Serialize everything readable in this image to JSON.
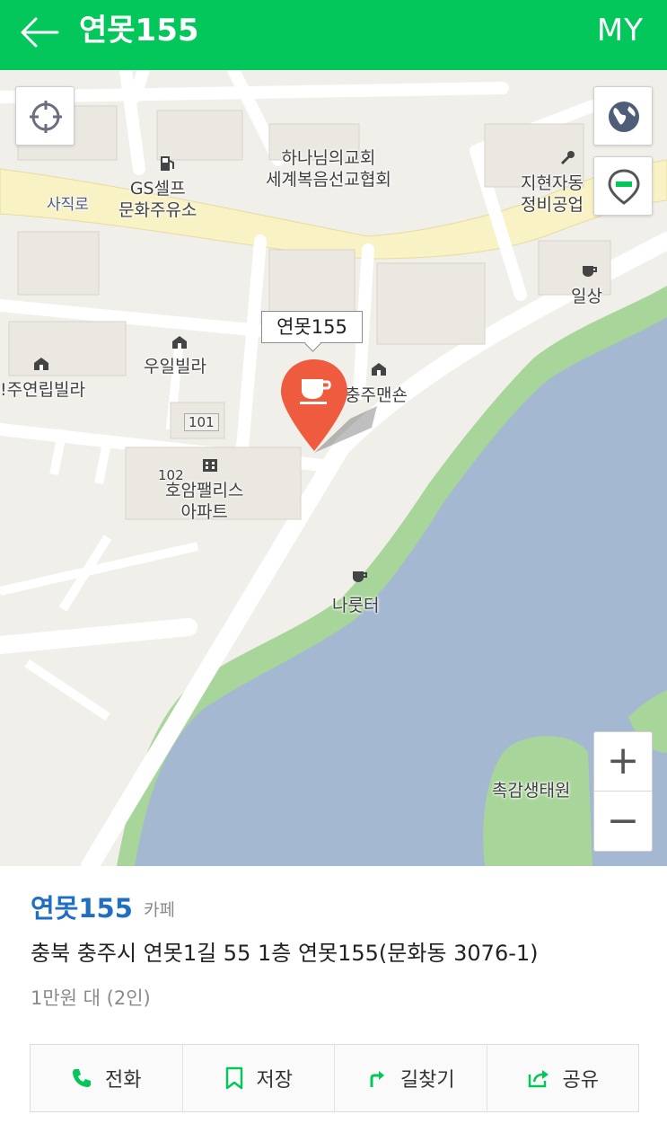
{
  "header": {
    "title": "연못155",
    "my_label": "MY"
  },
  "map": {
    "labels": {
      "road": "사직로",
      "church": "하나님의교회\n세계복음선교협회",
      "gas": "GS셀프\n문화주유소",
      "repair": "지현자동\n정비공업",
      "cafe1": "일상",
      "woo": "우일빌라",
      "yeonrip": "!주연립빌라",
      "mansion": "충주맨숀",
      "apt": "호암팰리스\n아파트",
      "narut": "나룻터",
      "park": "촉감생태원",
      "bldg101": "101",
      "bldg102": "102"
    },
    "callout": "연못155",
    "icons": {
      "locate": "crosshair-icon",
      "globe": "globe-icon",
      "layer": "location-pin-icon",
      "marker": "cafe-marker-icon"
    },
    "zoom_in": "+",
    "zoom_out": "−"
  },
  "place": {
    "name": "연못155",
    "category": "카페",
    "address": "충북 충주시 연못1길 55 1층 연못155(문화동 3076-1)",
    "price": "1만원 대 (2인)"
  },
  "actions": [
    {
      "label": "전화",
      "icon": "phone-icon"
    },
    {
      "label": "저장",
      "icon": "bookmark-icon"
    },
    {
      "label": "길찾기",
      "icon": "directions-icon"
    },
    {
      "label": "공유",
      "icon": "share-icon"
    }
  ],
  "colors": {
    "brand": "#03c75a",
    "link": "#1f6ec2",
    "marker": "#ef5b3f",
    "water": "#a4b8d2",
    "park": "#a8d59a",
    "road": "#f8f2c4"
  }
}
